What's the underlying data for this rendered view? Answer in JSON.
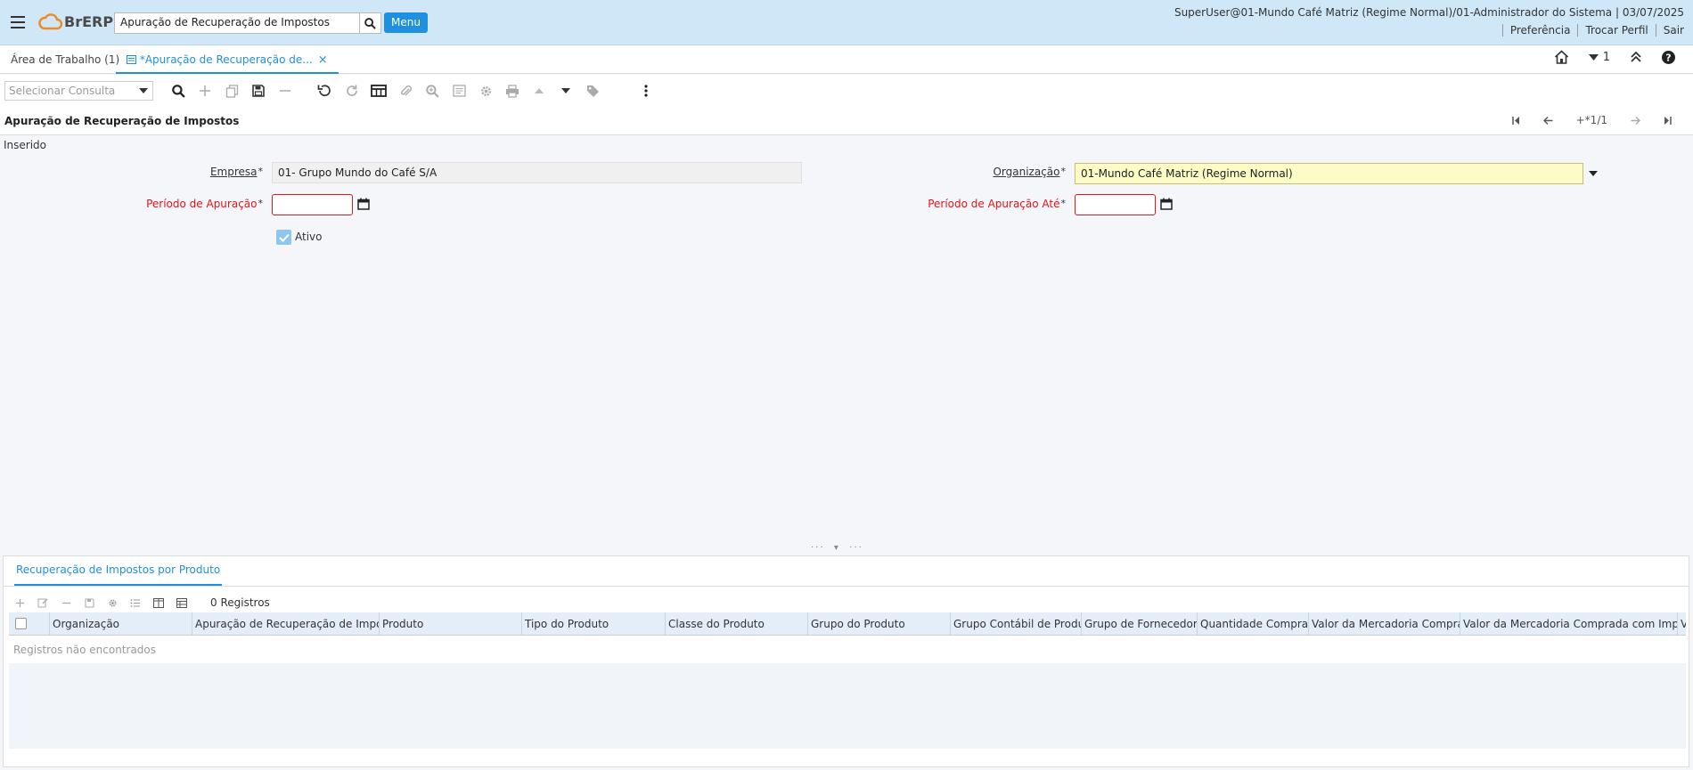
{
  "header": {
    "logo_text": "BrERP",
    "search_value": "Apuração de Recuperação de Impostos",
    "menu_label": "Menu",
    "user_info": "SuperUser@01-Mundo Café Matriz (Regime Normal)/01-Administrador do Sistema | 03/07/2025",
    "links": [
      "Preferência",
      "Trocar Perfil",
      "Sair"
    ]
  },
  "tabs": {
    "workspace": "Área de Trabalho (1)",
    "active": "*Apuração de Recuperação de...",
    "close": "×",
    "counter": "1"
  },
  "toolbar": {
    "query_placeholder": "Selecionar Consulta"
  },
  "window": {
    "title": "Apuração de Recuperação de Impostos",
    "record_indicator": "+*1/1",
    "status": "Inserido"
  },
  "form": {
    "empresa_label": "Empresa",
    "empresa_value": "01- Grupo Mundo do Café S/A",
    "organizacao_label": "Organização",
    "organizacao_value": "01-Mundo Café Matriz (Regime Normal)",
    "periodo_label": "Período de Apuração",
    "periodo_value": "",
    "periodo_ate_label": "Período de Apuração Até",
    "periodo_ate_value": "",
    "ativo_label": "Ativo",
    "ativo_checked": true,
    "required_mark": "*"
  },
  "detail": {
    "tab_label": "Recuperação de Impostos por Produto",
    "record_count": "0 Registros",
    "columns": [
      "Organização",
      "Apuração de Recuperação de Impostos",
      "Produto",
      "Tipo do Produto",
      "Classe do Produto",
      "Grupo do Produto",
      "Grupo Contábil de Produto",
      "Grupo de Fornecedores",
      "Quantidade Comprada",
      "Valor da Mercadoria Comprada",
      "Valor da Mercadoria Comprada com Impostos",
      "V"
    ],
    "empty_message": "Registros não encontrados"
  },
  "colors": {
    "header_bg": "#cfe7f7",
    "accent": "#1f8fe0",
    "required_red": "#e0161b",
    "mandatory_yellow": "#fdfcc6"
  }
}
